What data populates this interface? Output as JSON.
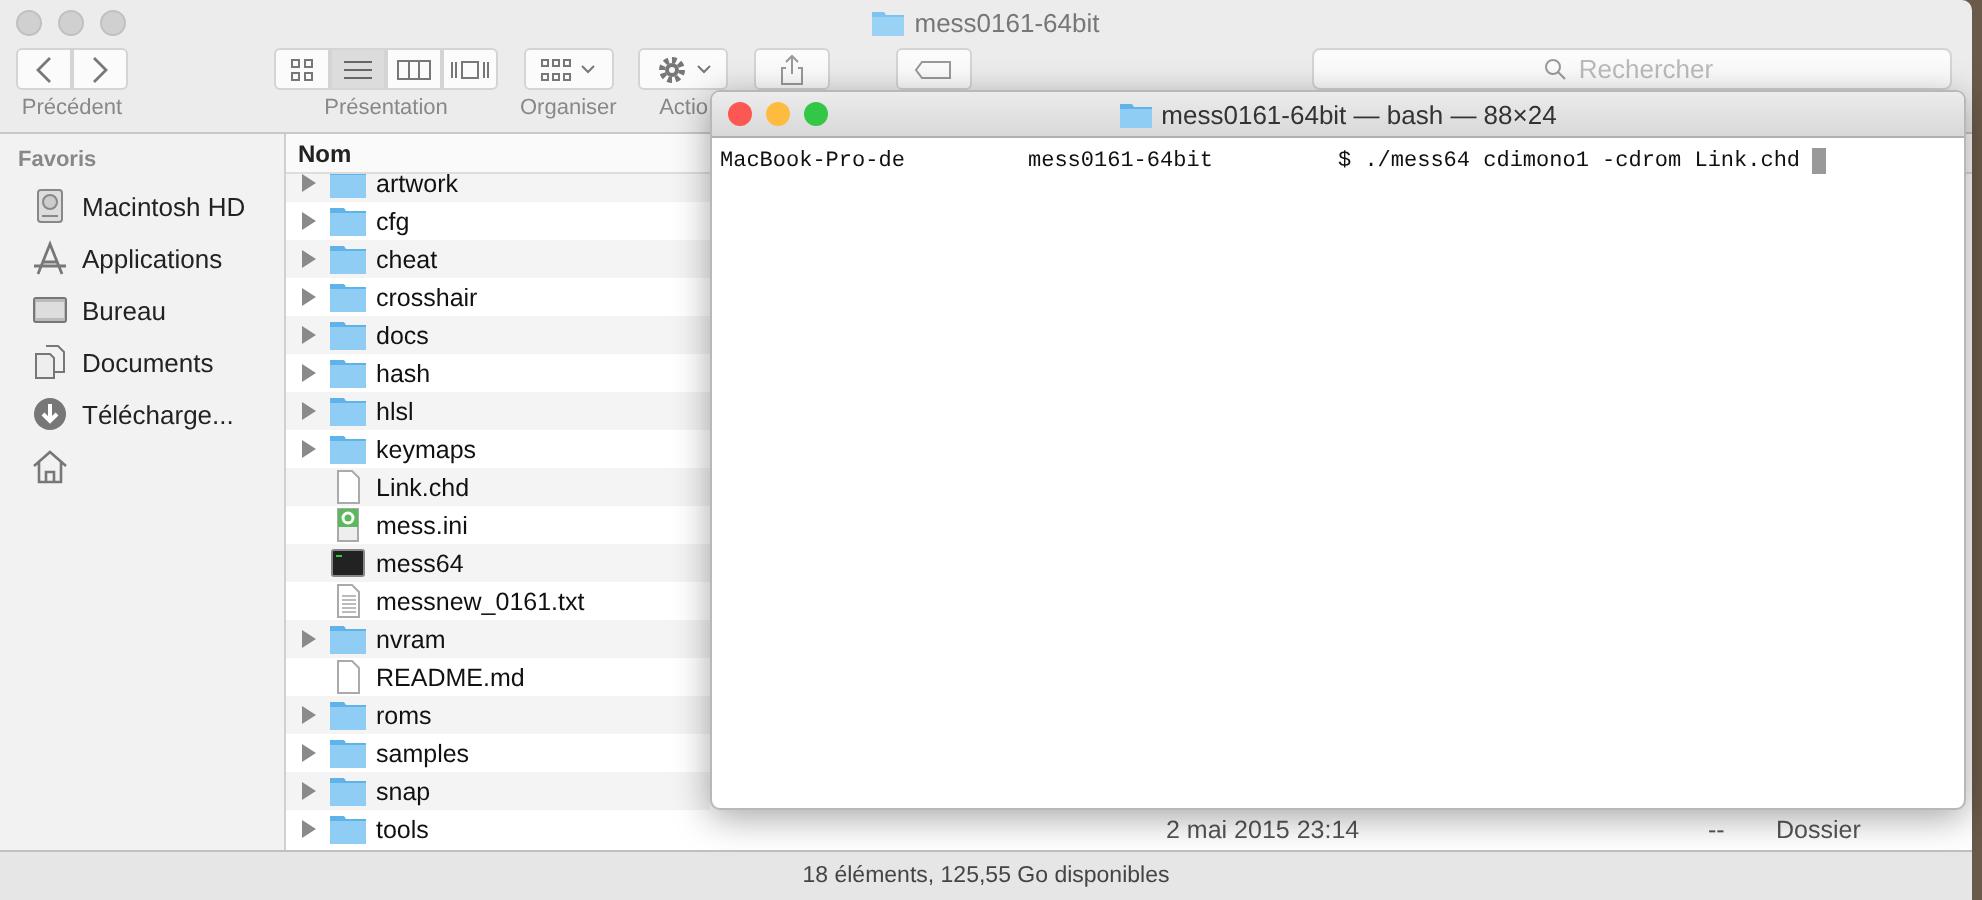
{
  "finder": {
    "title": "mess0161-64bit",
    "toolbar": {
      "back_label": "Précédent",
      "presentation_label": "Présentation",
      "view_modes": [
        {
          "kind": "icons",
          "selected": false
        },
        {
          "kind": "list",
          "selected": true
        },
        {
          "kind": "columns",
          "selected": false
        },
        {
          "kind": "coverflow",
          "selected": false
        }
      ],
      "organise_label": "Organiser",
      "action_label": "Actio",
      "search_placeholder": "Rechercher"
    },
    "sidebar": {
      "heading": "Favoris",
      "items": [
        {
          "label": "Macintosh HD",
          "kind": "disk"
        },
        {
          "label": "Applications",
          "kind": "apps"
        },
        {
          "label": "Bureau",
          "kind": "desktop"
        },
        {
          "label": "Documents",
          "kind": "documents"
        },
        {
          "label": "Télécharge...",
          "kind": "downloads"
        },
        {
          "kind": "home"
        }
      ]
    },
    "list": {
      "column": "Nom",
      "rows": [
        {
          "name": "artwork",
          "kind": "folder",
          "expanded": false
        },
        {
          "name": "cfg",
          "kind": "folder",
          "expanded": false
        },
        {
          "name": "cheat",
          "kind": "folder",
          "expanded": false
        },
        {
          "name": "crosshair",
          "kind": "folder",
          "expanded": false
        },
        {
          "name": "docs",
          "kind": "folder",
          "expanded": false
        },
        {
          "name": "hash",
          "kind": "folder",
          "expanded": false
        },
        {
          "name": "hlsl",
          "kind": "folder",
          "expanded": false
        },
        {
          "name": "keymaps",
          "kind": "folder",
          "expanded": false
        },
        {
          "name": "Link.chd",
          "kind": "file"
        },
        {
          "name": "mess.ini",
          "kind": "config"
        },
        {
          "name": "mess64",
          "kind": "exec"
        },
        {
          "name": "messnew_0161.txt",
          "kind": "text"
        },
        {
          "name": "nvram",
          "kind": "folder",
          "expanded": false
        },
        {
          "name": "README.md",
          "kind": "file"
        },
        {
          "name": "roms",
          "kind": "folder",
          "expanded": false
        },
        {
          "name": "samples",
          "kind": "folder",
          "expanded": false
        },
        {
          "name": "snap",
          "kind": "folder",
          "expanded": false
        },
        {
          "name": "tools",
          "kind": "folder",
          "expanded": false,
          "modified": "2 mai 2015 23:14",
          "size": "--",
          "type": "Dossier"
        }
      ]
    },
    "status": "18 éléments, 125,55 Go disponibles"
  },
  "terminal": {
    "title": "mess0161-64bit — bash — 88×24",
    "lines": [
      {
        "host": "MacBook-Pro-de",
        "dir": "mess0161-64bit",
        "command": "$ ./mess64 cdimono1 -cdrom Link.chd"
      }
    ]
  }
}
